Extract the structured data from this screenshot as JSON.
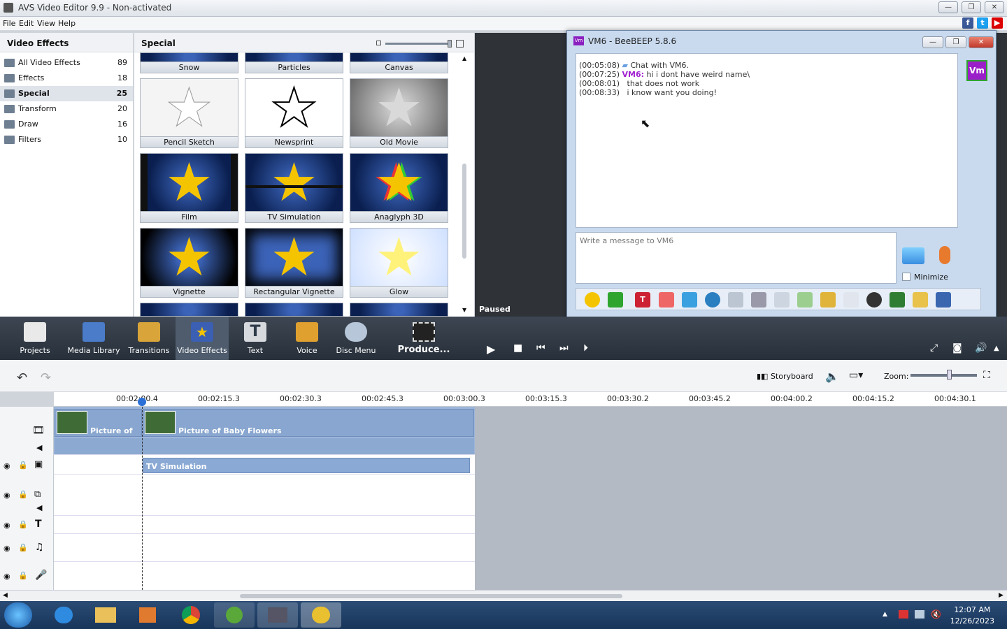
{
  "app": {
    "title": "AVS Video Editor 9.9 - Non-activated",
    "menu": [
      "File",
      "Edit",
      "View",
      "Help"
    ]
  },
  "left_panel": {
    "header": "Video Effects",
    "categories": [
      {
        "label": "All Video Effects",
        "count": "89"
      },
      {
        "label": "Effects",
        "count": "18"
      },
      {
        "label": "Special",
        "count": "25"
      },
      {
        "label": "Transform",
        "count": "20"
      },
      {
        "label": "Draw",
        "count": "16"
      },
      {
        "label": "Filters",
        "count": "10"
      }
    ]
  },
  "center_panel": {
    "header": "Special",
    "effects": [
      "Snow",
      "Particles",
      "Canvas",
      "Pencil Sketch",
      "Newsprint",
      "Old Movie",
      "Film",
      "TV Simulation",
      "Anaglyph 3D",
      "Vignette",
      "Rectangular Vignette",
      "Glow"
    ]
  },
  "preview": {
    "status": "Paused"
  },
  "toolbar": {
    "items": [
      "Projects",
      "Media Library",
      "Transitions",
      "Video Effects",
      "Text",
      "Voice",
      "Disc Menu"
    ],
    "produce": "Produce..."
  },
  "timeline": {
    "storyboard": "Storyboard",
    "zoom_label": "Zoom:",
    "ticks": [
      "00:02:00.4",
      "00:02:15.3",
      "00:02:30.3",
      "00:02:45.3",
      "00:03:00.3",
      "00:03:15.3",
      "00:03:30.2",
      "00:03:45.2",
      "00:04:00.2",
      "00:04:15.2",
      "00:04:30.1"
    ],
    "clips": [
      "Picture of ...",
      "Picture of Baby Flowers"
    ],
    "effect_clip": "TV Simulation"
  },
  "chat": {
    "title": "VM6 - BeeBEEP 5.8.6",
    "avatar": "Vm",
    "messages": [
      {
        "time": "(00:05:08)",
        "user": "",
        "text": "Chat with VM6."
      },
      {
        "time": "(00:07:25)",
        "user": "VM6:",
        "text": "hi i dont have weird name\\"
      },
      {
        "time": "(00:08:01)",
        "user": "",
        "text": "that does not work"
      },
      {
        "time": "(00:08:33)",
        "user": "",
        "text": "i know want you doing!"
      }
    ],
    "input_placeholder": "Write a message to VM6",
    "minimize_label": "Minimize"
  },
  "taskbar": {
    "time": "12:07 AM",
    "date": "12/26/2023"
  }
}
